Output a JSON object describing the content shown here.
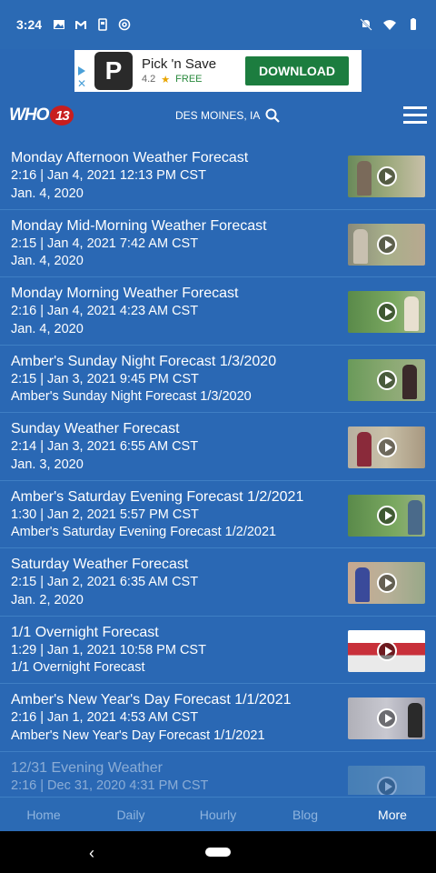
{
  "status_bar": {
    "time": "3:24",
    "left_icons": [
      "image-icon",
      "gmail-icon",
      "sim-icon",
      "at-icon"
    ],
    "right_icons": [
      "mute-icon",
      "wifi-icon",
      "battery-icon"
    ]
  },
  "ad": {
    "logo_letter": "P",
    "title": "Pick 'n Save",
    "rating": "4.2",
    "price": "FREE",
    "button": "DOWNLOAD"
  },
  "header": {
    "logo_text": "WHO",
    "logo_number": "13",
    "location": "DES MOINES, IA"
  },
  "videos": [
    {
      "title": "Monday Afternoon Weather Forecast",
      "meta": "2:16 | Jan 4, 2021 12:13 PM CST",
      "desc": "Jan. 4, 2020"
    },
    {
      "title": "Monday Mid-Morning Weather Forecast",
      "meta": "2:15 | Jan 4, 2021 7:42 AM CST",
      "desc": "Jan. 4, 2020"
    },
    {
      "title": "Monday Morning Weather Forecast",
      "meta": "2:16 | Jan 4, 2021 4:23 AM CST",
      "desc": "Jan. 4, 2020"
    },
    {
      "title": "Amber's Sunday Night Forecast 1/3/2020",
      "meta": "2:15 | Jan 3, 2021 9:45 PM CST",
      "desc": "Amber's Sunday Night Forecast 1/3/2020"
    },
    {
      "title": "Sunday Weather Forecast",
      "meta": "2:14 | Jan 3, 2021 6:55 AM CST",
      "desc": "Jan. 3, 2020"
    },
    {
      "title": "Amber's Saturday Evening Forecast 1/2/2021",
      "meta": "1:30 | Jan 2, 2021 5:57 PM CST",
      "desc": "Amber's Saturday Evening Forecast 1/2/2021"
    },
    {
      "title": "Saturday Weather Forecast",
      "meta": "2:15 | Jan 2, 2021 6:35 AM CST",
      "desc": "Jan. 2, 2020"
    },
    {
      "title": "1/1 Overnight Forecast",
      "meta": "1:29 | Jan 1, 2021 10:58 PM CST",
      "desc": "1/1 Overnight Forecast"
    },
    {
      "title": "Amber's New Year's Day Forecast 1/1/2021",
      "meta": "2:16 | Jan 1, 2021 4:53 AM CST",
      "desc": "Amber's New Year's Day Forecast 1/1/2021"
    },
    {
      "title": "12/31 Evening Weather",
      "meta": "2:16 | Dec 31, 2020 4:31 PM CST",
      "desc": ""
    }
  ],
  "bottom_nav": {
    "items": [
      "Home",
      "Daily",
      "Hourly",
      "Blog",
      "More"
    ],
    "active": "More"
  },
  "colors": {
    "background": "#2a68b4",
    "ad_button": "#1c7d3f",
    "logo_red": "#c81e1e"
  }
}
